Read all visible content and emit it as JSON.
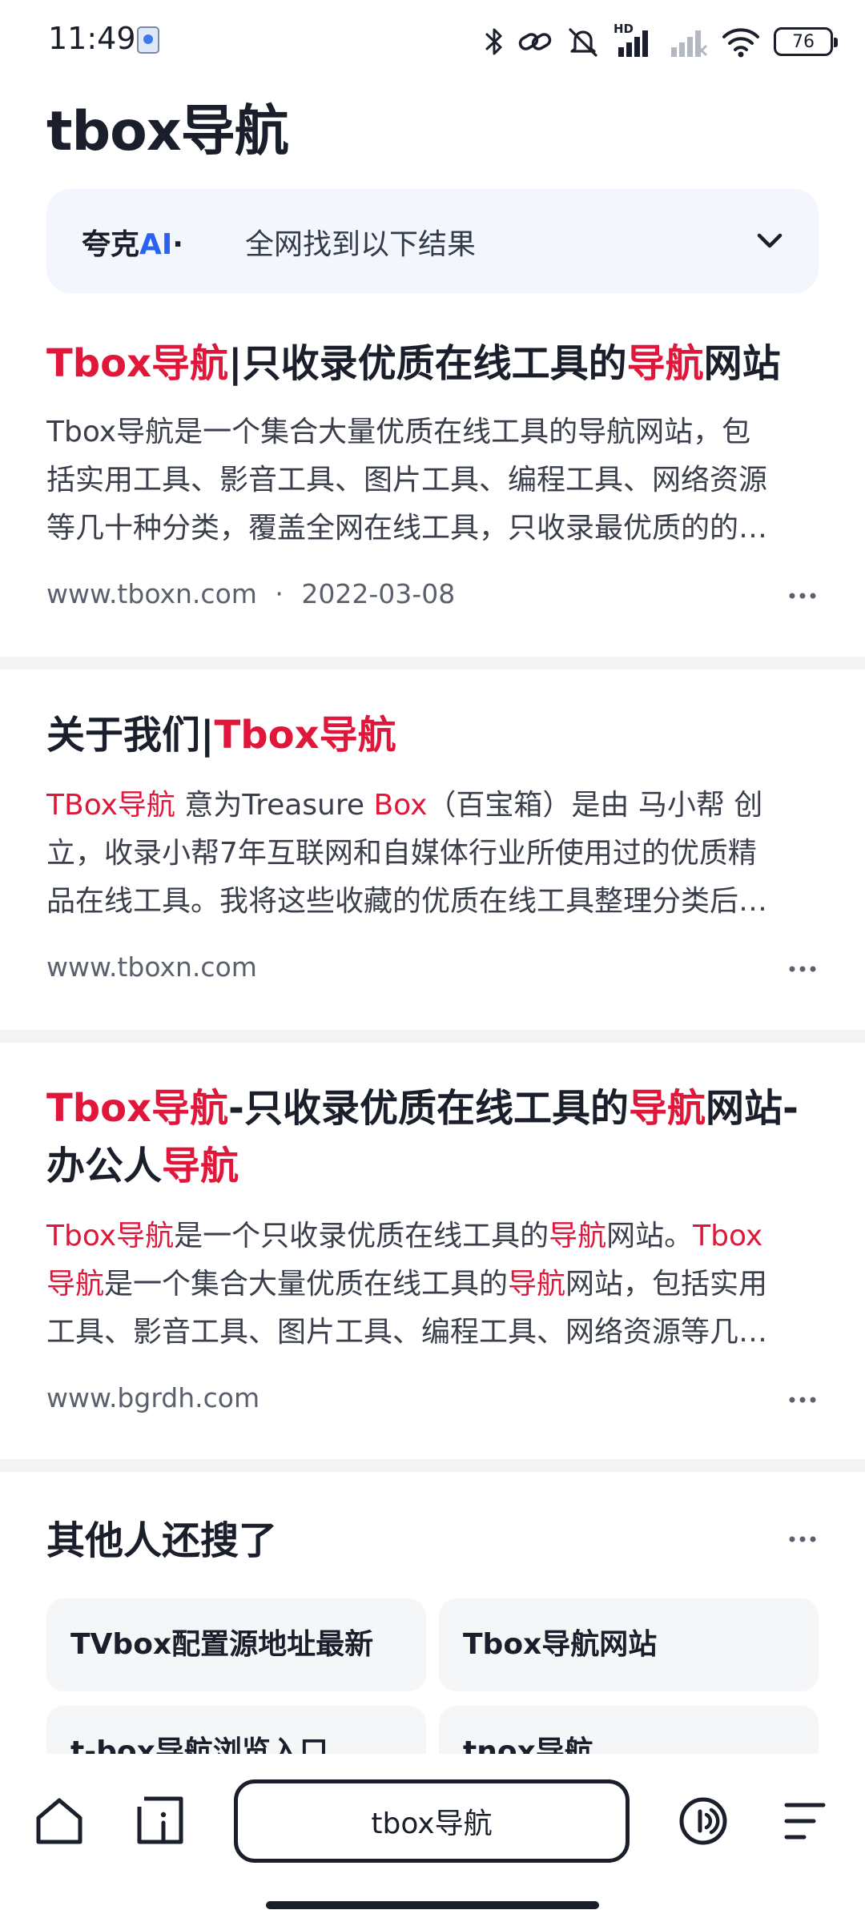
{
  "status": {
    "time": "11:49",
    "battery": "76",
    "network_badge": "HD"
  },
  "query": "tbox导航",
  "ai": {
    "brand_main": "夸克",
    "brand_accent": "AI",
    "separator": "·",
    "subtitle": "全网找到以下结果"
  },
  "results": [
    {
      "title_parts": [
        {
          "text": "Tbox导航",
          "hl": true
        },
        {
          "text": "|只收录优质在线工具的",
          "hl": false
        },
        {
          "text": "导航",
          "hl": true
        },
        {
          "text": "网站",
          "hl": false
        }
      ],
      "snippet_lines": [
        [
          {
            "text": "Tbox导航是一个集合大量优质在线工具的导航网站，包",
            "hl": false
          }
        ],
        [
          {
            "text": "括实用工具、影音工具、图片工具、编程工具、网络资源",
            "hl": false
          }
        ],
        [
          {
            "text": "等几十种分类，覆盖全网在线工具，只收录最优质的的…",
            "hl": false
          }
        ]
      ],
      "site": "www.tboxn.com",
      "meta_separator": "·",
      "date": "2022-03-08"
    },
    {
      "title_parts": [
        {
          "text": "关于我们|",
          "hl": false
        },
        {
          "text": "Tbox导航",
          "hl": true
        }
      ],
      "snippet_lines": [
        [
          {
            "text": "TBox导航",
            "hl": true
          },
          {
            "text": " 意为Treasure ",
            "hl": false
          },
          {
            "text": "Box",
            "hl": true
          },
          {
            "text": "（百宝箱）是由 马小帮 创",
            "hl": false
          }
        ],
        [
          {
            "text": "立，收录小帮7年互联网和自媒体行业所使用过的优质精",
            "hl": false
          }
        ],
        [
          {
            "text": "品在线工具。我将这些收藏的优质在线工具整理分类后…",
            "hl": false
          }
        ]
      ],
      "site": "www.tboxn.com",
      "meta_separator": "",
      "date": ""
    },
    {
      "title_lines": [
        [
          {
            "text": "Tbox导航",
            "hl": true
          },
          {
            "text": "-只收录优质在线工具的",
            "hl": false
          },
          {
            "text": "导航",
            "hl": true
          },
          {
            "text": "网站-",
            "hl": false
          }
        ],
        [
          {
            "text": "办公人",
            "hl": false
          },
          {
            "text": "导航",
            "hl": true
          }
        ]
      ],
      "snippet_lines": [
        [
          {
            "text": "Tbox导航",
            "hl": true
          },
          {
            "text": "是一个只收录优质在线工具的",
            "hl": false
          },
          {
            "text": "导航",
            "hl": true
          },
          {
            "text": "网站。",
            "hl": false
          },
          {
            "text": "Tbox",
            "hl": true
          }
        ],
        [
          {
            "text": "导航",
            "hl": true
          },
          {
            "text": "是一个集合大量优质在线工具的",
            "hl": false
          },
          {
            "text": "导航",
            "hl": true
          },
          {
            "text": "网站，包括实用",
            "hl": false
          }
        ],
        [
          {
            "text": "工具、影音工具、图片工具、编程工具、网络资源等几…",
            "hl": false
          }
        ]
      ],
      "site": "www.bgrdh.com",
      "meta_separator": "",
      "date": ""
    }
  ],
  "others": {
    "title": "其他人还搜了",
    "chips": [
      "TVbox配置源地址最新",
      "Tbox导航网站",
      "t-box导航浏览入口",
      "tnox导航"
    ]
  },
  "bottom_bar": {
    "search_text": "tbox导航"
  },
  "colors": {
    "highlight": "#e0173b",
    "ai_accent": "#2b63f0",
    "text": "#1a1f2b"
  },
  "icons": [
    "home-icon",
    "tabs-icon",
    "voice-icon",
    "menu-icon",
    "chevron-down-icon",
    "more-icon"
  ]
}
